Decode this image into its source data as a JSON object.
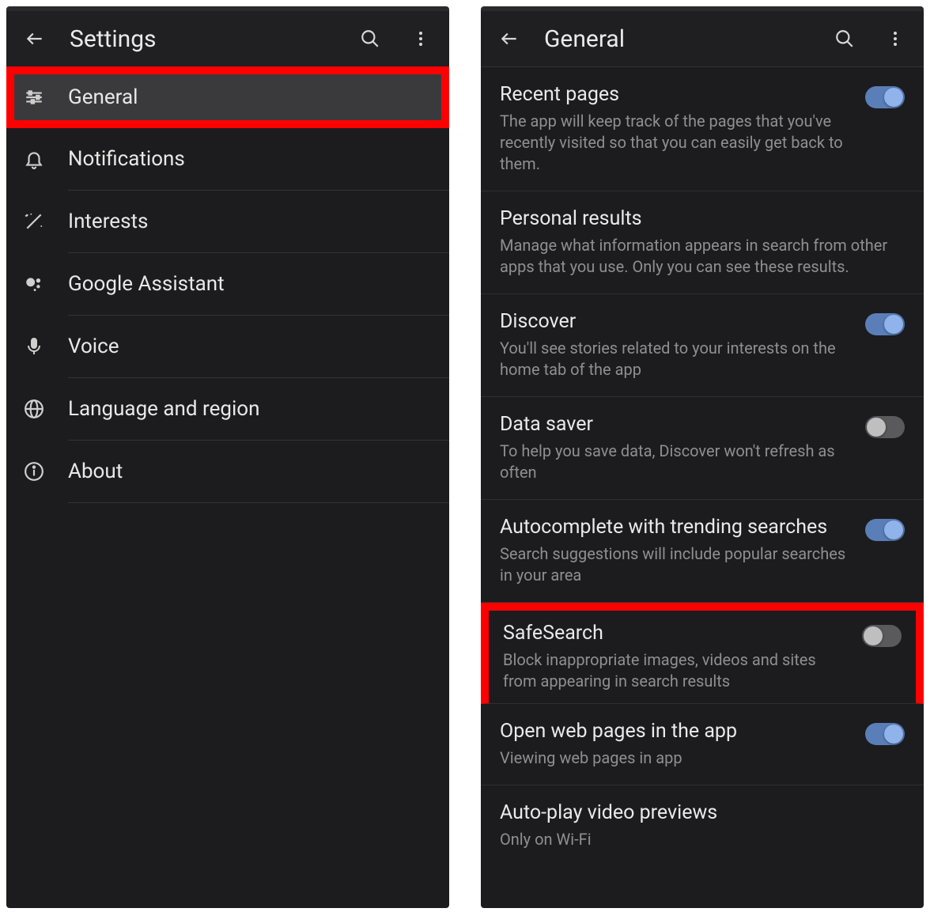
{
  "left": {
    "title": "Settings",
    "items": [
      {
        "label": "General",
        "icon": "sliders-icon",
        "selected": true,
        "highlight": true
      },
      {
        "label": "Notifications",
        "icon": "bell-icon"
      },
      {
        "label": "Interests",
        "icon": "wand-icon"
      },
      {
        "label": "Google Assistant",
        "icon": "assistant-icon"
      },
      {
        "label": "Voice",
        "icon": "mic-icon"
      },
      {
        "label": "Language and region",
        "icon": "globe-icon"
      },
      {
        "label": "About",
        "icon": "info-icon"
      }
    ]
  },
  "right": {
    "title": "General",
    "items": [
      {
        "title": "Recent pages",
        "sub": "The app will keep track of the pages that you've recently visited so that you can easily get back to them.",
        "toggle": "on"
      },
      {
        "title": "Personal results",
        "sub": "Manage what information appears in search from other apps that you use. Only you can see these results."
      },
      {
        "title": "Discover",
        "sub": "You'll see stories related to your interests on the home tab of the app",
        "toggle": "on"
      },
      {
        "title": "Data saver",
        "sub": "To help you save data, Discover won't refresh as often",
        "toggle": "off"
      },
      {
        "title": "Autocomplete with trending searches",
        "sub": "Search suggestions will include popular searches in your area",
        "toggle": "on"
      },
      {
        "title": "SafeSearch",
        "sub": "Block inappropriate images, videos and sites from appearing in search results",
        "toggle": "off",
        "highlight": true
      },
      {
        "title": "Open web pages in the app",
        "sub": "Viewing web pages in app",
        "toggle": "on"
      },
      {
        "title": "Auto-play video previews",
        "sub": "Only on Wi-Fi"
      }
    ]
  }
}
